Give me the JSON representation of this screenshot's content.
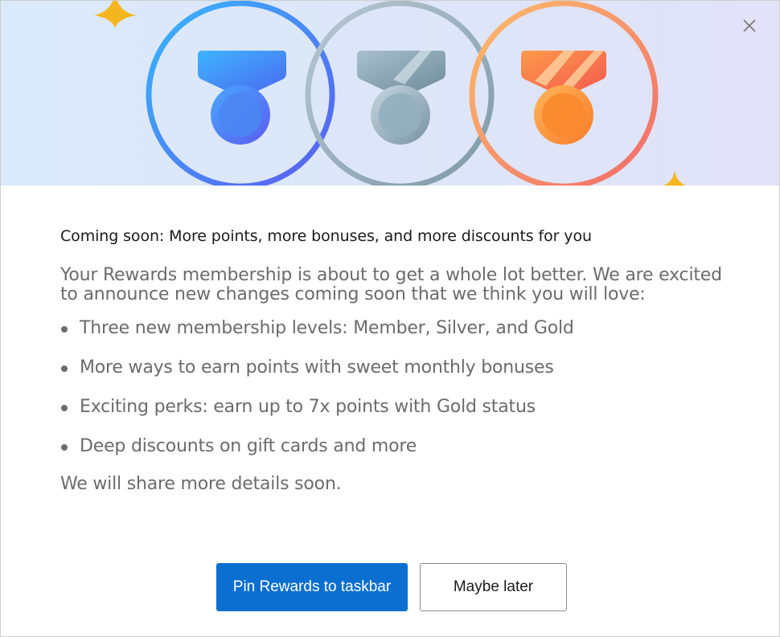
{
  "hero": {
    "medals": [
      {
        "name": "member",
        "color": "#3b82f6"
      },
      {
        "name": "silver",
        "color": "#8fa9b8"
      },
      {
        "name": "gold",
        "color": "#f59e42"
      }
    ]
  },
  "dialog": {
    "heading": "Coming soon: More points, more bonuses, and more discounts for you",
    "intro": "Your Rewards membership is about to get a whole lot better. We are excited to announce new changes coming soon that we think you will love:",
    "bullets": [
      "Three new membership levels: Member, Silver, and Gold",
      "More ways to earn points with sweet monthly bonuses",
      "Exciting perks: earn up to 7x points with Gold status",
      "Deep discounts on gift cards and more"
    ],
    "outro": "We will share more details soon.",
    "primary_button": "Pin Rewards to taskbar",
    "secondary_button": "Maybe later"
  },
  "icons": {
    "close": "close-icon"
  },
  "colors": {
    "primary": "#0a6fd0",
    "text": "#1a1a1a",
    "muted": "#6b6b6b"
  }
}
